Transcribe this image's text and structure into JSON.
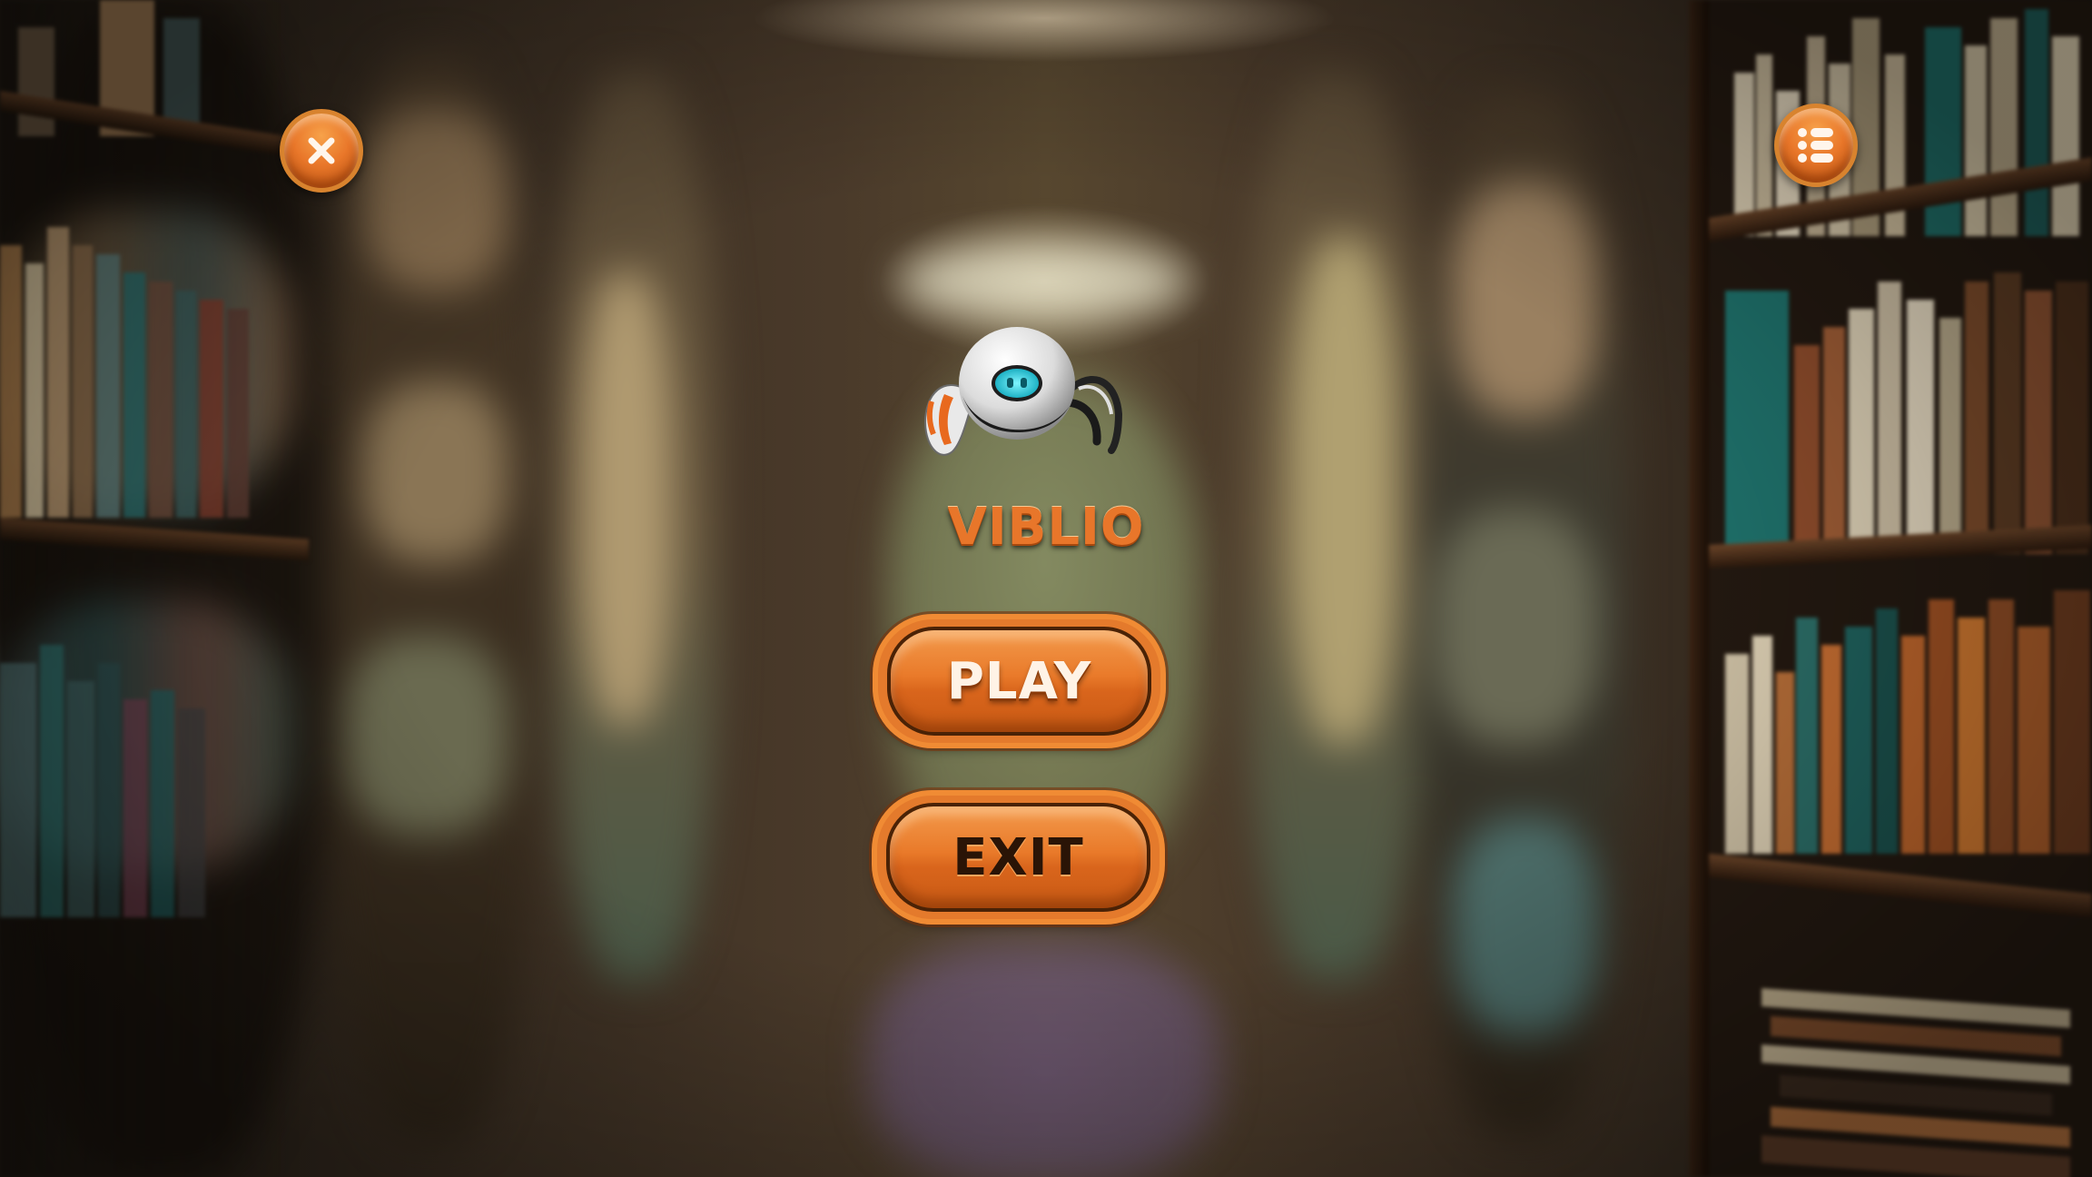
{
  "game": {
    "title": "VIBLIO",
    "play_label": "PLAY",
    "exit_label": "EXIT"
  },
  "icons": {
    "close": "close-icon",
    "menu": "menu-list-icon",
    "mascot": "robot-mascot"
  },
  "colors": {
    "accent": "#e8772a",
    "button_border": "#4a2206",
    "title": "#e8762a"
  }
}
